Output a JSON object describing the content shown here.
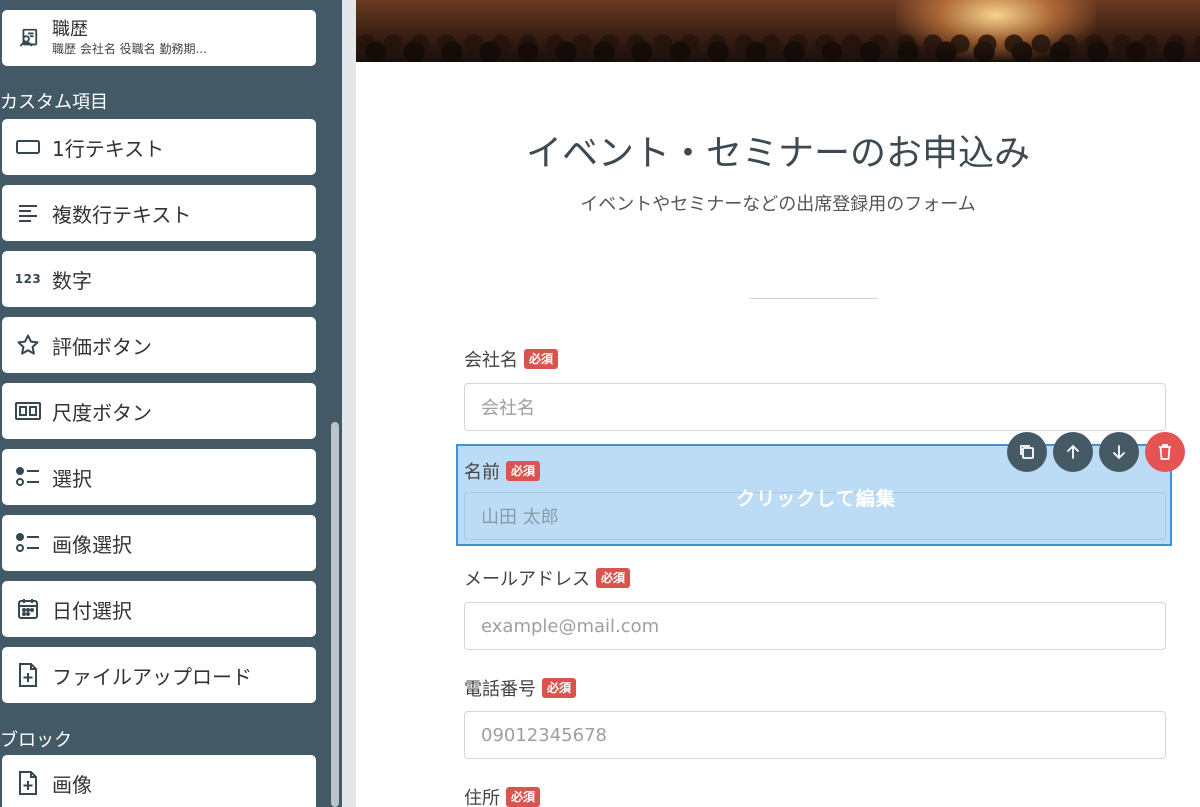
{
  "sidebar": {
    "career_card": {
      "label": "職歴",
      "sub": "職歴 会社名 役職名 勤務期..."
    },
    "custom_section": "カスタム項目",
    "custom_items": [
      {
        "label": "1行テキスト",
        "icon": "single-line-text-icon"
      },
      {
        "label": "複数行テキスト",
        "icon": "multi-line-text-icon"
      },
      {
        "label": "数字",
        "icon": "number-icon",
        "glyph": "123"
      },
      {
        "label": "評価ボタン",
        "icon": "star-icon"
      },
      {
        "label": "尺度ボタン",
        "icon": "scale-icon"
      },
      {
        "label": "選択",
        "icon": "select-list-icon"
      },
      {
        "label": "画像選択",
        "icon": "image-select-icon"
      },
      {
        "label": "日付選択",
        "icon": "calendar-icon"
      },
      {
        "label": "ファイルアップロード",
        "icon": "file-upload-icon"
      }
    ],
    "block_section": "ブロック",
    "block_items": [
      {
        "label": "画像",
        "icon": "image-block-icon"
      }
    ]
  },
  "form": {
    "title": "イベント・セミナーのお申込み",
    "subtitle": "イベントやセミナーなどの出席登録用のフォーム",
    "required_badge": "必須",
    "fields": [
      {
        "label": "会社名",
        "placeholder": "会社名"
      },
      {
        "label": "名前",
        "placeholder": "山田 太郎"
      },
      {
        "label": "メールアドレス",
        "placeholder": "example@mail.com"
      },
      {
        "label": "電話番号",
        "placeholder": "09012345678"
      },
      {
        "label": "住所"
      }
    ],
    "edit_hint": "クリックして編集"
  },
  "toolbar": {
    "icons": [
      "duplicate-icon",
      "move-up-icon",
      "move-down-icon",
      "delete-icon"
    ]
  },
  "colors": {
    "sidebar_bg": "#435a66",
    "badge": "#d9534f",
    "selected_bg": "#bcdcf6",
    "selected_border": "#3d94d6",
    "tool_btn": "#455a64",
    "delete_btn": "#e55353"
  }
}
